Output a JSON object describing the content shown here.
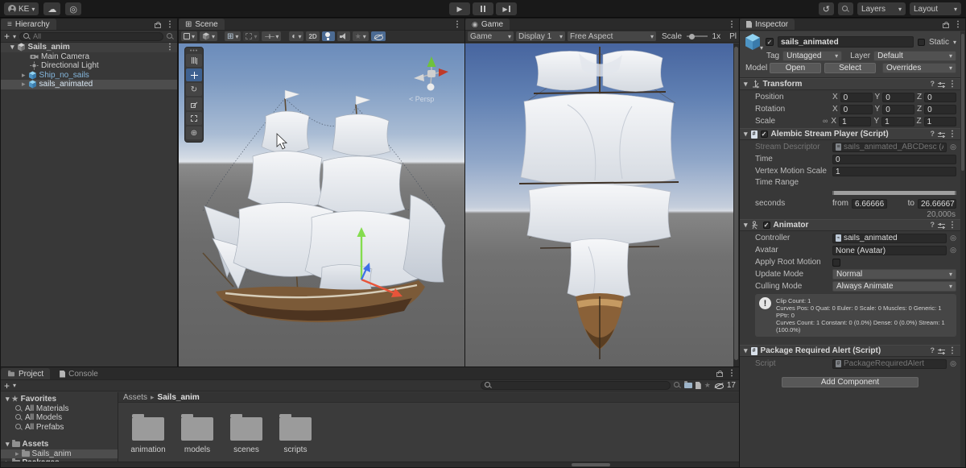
{
  "topbar": {
    "account": "KE",
    "layers": "Layers",
    "layout": "Layout"
  },
  "hierarchy": {
    "tab": "Hierarchy",
    "search_placeholder": "All",
    "scene_row": "Sails_anim",
    "items": [
      {
        "label": "Main Camera"
      },
      {
        "label": "Directional Light"
      },
      {
        "label": "Ship_no_sails"
      },
      {
        "label": "sails_animated"
      }
    ]
  },
  "scene": {
    "tab": "Scene",
    "btn_2d": "2D",
    "persp": "Persp"
  },
  "game": {
    "tab": "Game",
    "mode": "Game",
    "display": "Display 1",
    "aspect": "Free Aspect",
    "scale_label": "Scale",
    "scale_value": "1x",
    "play_clipped": "Pl"
  },
  "inspector": {
    "tab": "Inspector",
    "name": "sails_animated",
    "static_label": "Static",
    "tag_label": "Tag",
    "tag_value": "Untagged",
    "layer_label": "Layer",
    "layer_value": "Default",
    "model_label": "Model",
    "open_btn": "Open",
    "select_btn": "Select",
    "overrides_btn": "Overrides",
    "transform": {
      "title": "Transform",
      "position_label": "Position",
      "rotation_label": "Rotation",
      "scale_label": "Scale",
      "x_label": "X",
      "y_label": "Y",
      "z_label": "Z",
      "position": {
        "x": "0",
        "y": "0",
        "z": "0"
      },
      "rotation": {
        "x": "0",
        "y": "0",
        "z": "0"
      },
      "scale": {
        "x": "1",
        "y": "1",
        "z": "1"
      }
    },
    "alembic": {
      "title": "Alembic Stream Player (Script)",
      "stream_label": "Stream Descriptor",
      "stream_value": "sails_animated_ABCDesc (Alembic",
      "time_label": "Time",
      "time_value": "0",
      "vertex_label": "Vertex Motion Scale",
      "vertex_value": "1",
      "range_label": "Time Range",
      "seconds_label": "seconds",
      "from_label": "from",
      "from_value": "6.66666",
      "to_label": "to",
      "to_value": "26.66667",
      "duration": "20,000s"
    },
    "animator": {
      "title": "Animator",
      "controller_label": "Controller",
      "controller_value": "sails_animated",
      "avatar_label": "Avatar",
      "avatar_value": "None (Avatar)",
      "root_motion_label": "Apply Root Motion",
      "update_label": "Update Mode",
      "update_value": "Normal",
      "culling_label": "Culling Mode",
      "culling_value": "Always Animate",
      "info_line1": "Clip Count: 1",
      "info_line2": "Curves Pos: 0 Quat: 0 Euler: 0 Scale: 0 Muscles: 0 Generic: 1 PPtr: 0",
      "info_line3": "Curves Count: 1 Constant: 0 (0.0%) Dense: 0 (0.0%) Stream: 1 (100.0%)"
    },
    "package_alert": {
      "title": "Package Required Alert (Script)",
      "script_label": "Script",
      "script_value": "PackageRequiredAlert"
    },
    "add_component": "Add Component"
  },
  "project": {
    "tab": "Project",
    "console_tab": "Console",
    "favorites_label": "Favorites",
    "favorites": [
      {
        "label": "All Materials"
      },
      {
        "label": "All Models"
      },
      {
        "label": "All Prefabs"
      }
    ],
    "assets_label": "Assets",
    "assets_child": "Sails_anim",
    "packages_label": "Packages",
    "breadcrumb_root": "Assets",
    "breadcrumb_current": "Sails_anim",
    "folders": [
      {
        "label": "animation"
      },
      {
        "label": "models"
      },
      {
        "label": "scenes"
      },
      {
        "label": "scripts"
      }
    ],
    "hidden_count": "17"
  }
}
